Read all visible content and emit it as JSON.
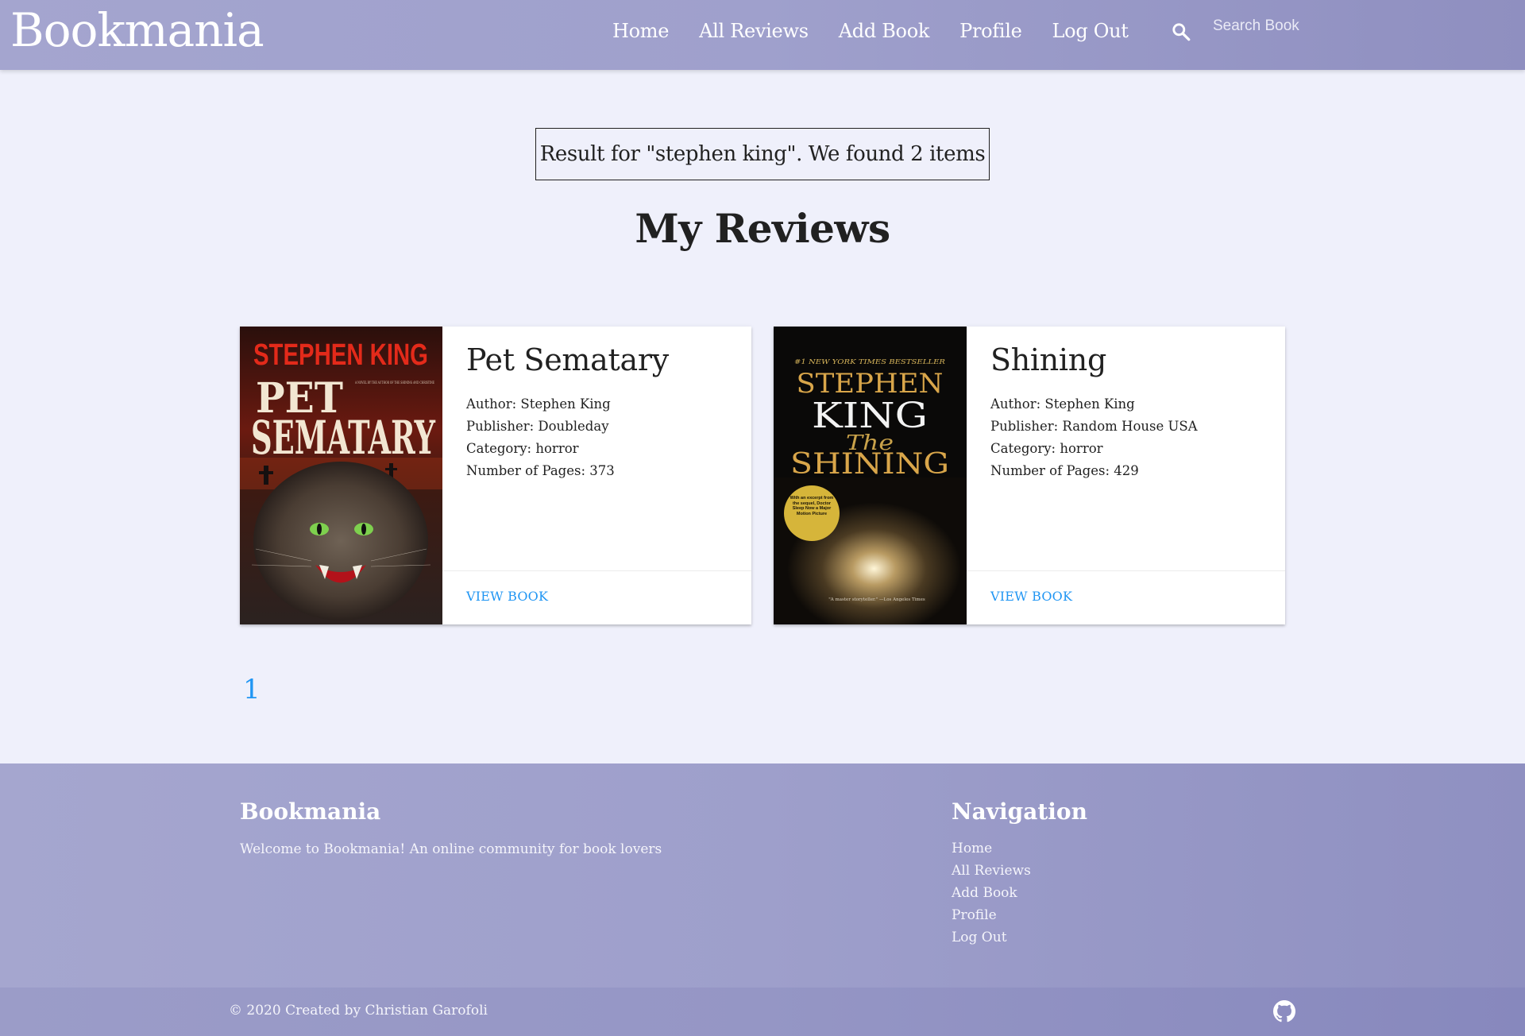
{
  "navbar": {
    "brand": "Bookmania",
    "links": [
      "Home",
      "All Reviews",
      "Add Book",
      "Profile",
      "Log Out"
    ],
    "search_placeholder": "Search Book",
    "search_icon": "search-icon"
  },
  "search_result": {
    "text": "Result for \"stephen king\". We found 2 items"
  },
  "section_title": "My Reviews",
  "books": [
    {
      "title": "Pet Sematary",
      "author": "Author: Stephen King",
      "publisher": "Publisher: Doubleday",
      "category": "Category: horror",
      "pages": "Number of Pages: 373",
      "action": "VIEW BOOK",
      "cover": {
        "author_line": "STEPHEN KING",
        "title_line_1": "PET",
        "title_line_2": "SEMATARY",
        "tagline": "A NOVEL BY THE AUTHOR OF THE SHINING AND CHRISTINE"
      }
    },
    {
      "title": "Shining",
      "author": "Author: Stephen King",
      "publisher": "Publisher: Random House USA",
      "category": "Category: horror",
      "pages": "Number of Pages: 429",
      "action": "VIEW BOOK",
      "cover": {
        "top_line": "#1 NEW YORK TIMES BESTSELLER",
        "author_line_1": "STEPHEN",
        "author_line_2": "KING",
        "title_the": "The",
        "title_main": "SHINING",
        "badge": "With an excerpt from the sequel, Doctor Sleep Now a Major Motion Picture",
        "quote": "\"A master storyteller.\" —Los Angeles Times"
      }
    }
  ],
  "pagination": {
    "current": "1"
  },
  "footer": {
    "brand_title": "Bookmania",
    "brand_text": "Welcome to Bookmania! An online community for book lovers",
    "nav_title": "Navigation",
    "nav_links": [
      "Home",
      "All Reviews",
      "Add Book",
      "Profile",
      "Log Out"
    ],
    "copyright": "© 2020 Created by Christian Garofoli",
    "github_icon": "github-icon"
  },
  "colors": {
    "header_gradient_start": "#a4a5cf",
    "header_gradient_end": "#8f8fc0",
    "page_background": "#eff0fb",
    "link_blue": "#2196f3"
  }
}
